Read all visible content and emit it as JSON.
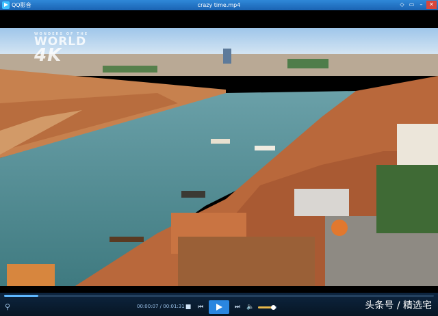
{
  "app": {
    "name": "QQ影音",
    "window_title": "crazy time.mp4"
  },
  "window_controls": {
    "skin": "◇",
    "restore": "▭",
    "minimize": "–",
    "close": "✕"
  },
  "video": {
    "watermark": {
      "small": "WONDERS OF THE",
      "line1": "WORLD",
      "line2": "4K"
    }
  },
  "player": {
    "time": "00:00:07 / 00:01:31",
    "progress": 0.08,
    "volume": 0.8,
    "colors": {
      "accent": "#2a86e0",
      "progress": "#5fb8ff",
      "volume": "#e8b84a"
    }
  },
  "overlay": {
    "credit": "头条号 / 精选宅"
  },
  "icons": {
    "tools": "tools-icon",
    "stop": "stop-icon",
    "prev": "previous-icon",
    "play": "play-icon",
    "next": "next-icon",
    "volume": "volume-icon"
  }
}
